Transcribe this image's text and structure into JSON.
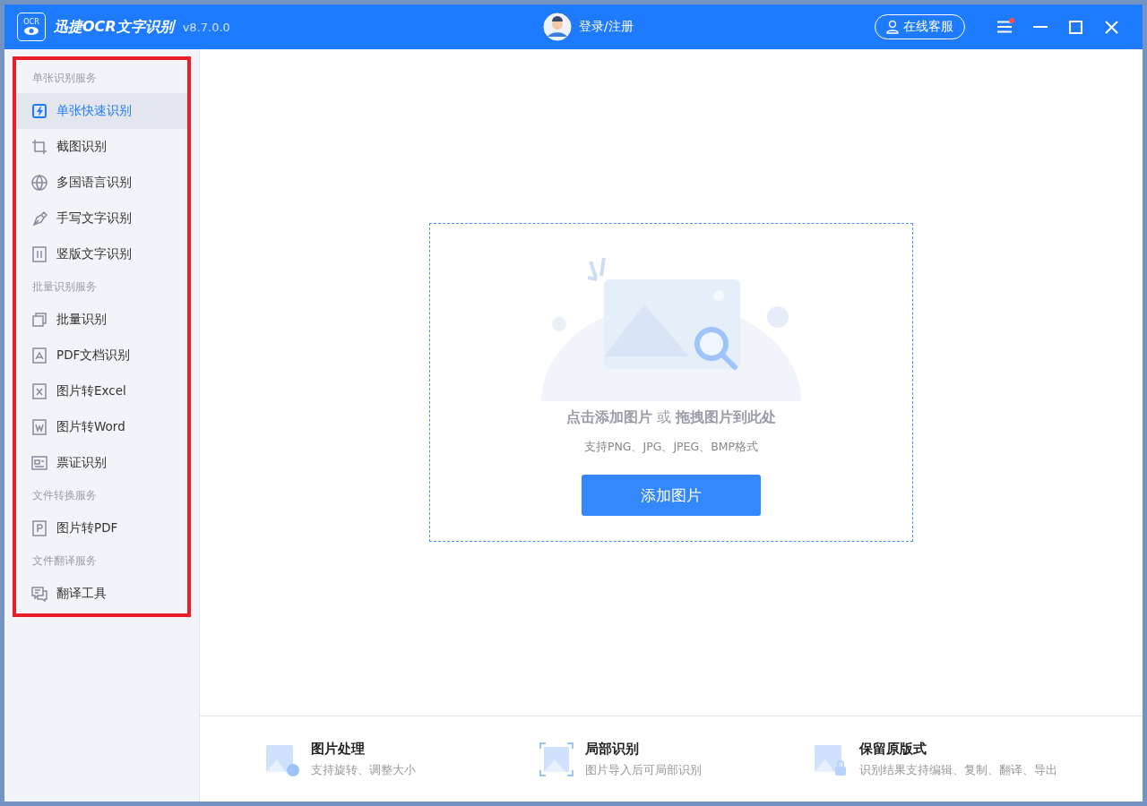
{
  "app": {
    "logo_text": "OCR",
    "title": "迅捷OCR文字识别",
    "version": "v8.7.0.0",
    "login": "登录/注册",
    "service": "在线客服",
    "menu_badge": true
  },
  "sidebar": {
    "highlighted": true,
    "groups": [
      {
        "title": "单张识别服务",
        "items": [
          {
            "label": "单张快速识别",
            "selected": true
          },
          {
            "label": "截图识别",
            "selected": false
          },
          {
            "label": "多国语言识别",
            "selected": false
          },
          {
            "label": "手写文字识别",
            "selected": false
          },
          {
            "label": "竖版文字识别",
            "selected": false
          }
        ]
      },
      {
        "title": "批量识别服务",
        "items": [
          {
            "label": "批量识别",
            "selected": false
          },
          {
            "label": "PDF文档识别",
            "selected": false
          },
          {
            "label": "图片转Excel",
            "selected": false
          },
          {
            "label": "图片转Word",
            "selected": false
          },
          {
            "label": "票证识别",
            "selected": false
          }
        ]
      },
      {
        "title": "文件转换服务",
        "items": [
          {
            "label": "图片转PDF",
            "selected": false
          }
        ]
      },
      {
        "title": "文件翻译服务",
        "items": [
          {
            "label": "翻译工具",
            "selected": false
          }
        ]
      }
    ]
  },
  "dropzone": {
    "headline": "**点击添加图片** 或 **拖拽图片到此处**",
    "formats": "支持PNG、JPG、JPEG、BMP格式",
    "button": "添加图片"
  },
  "features": [
    {
      "title": "图片处理",
      "desc": "支持旋转、调整大小"
    },
    {
      "title": "局部识别",
      "desc": "图片导入后可局部识别"
    },
    {
      "title": "保留原版式",
      "desc": "识别结果支持编辑、复制、翻译、导出"
    }
  ]
}
